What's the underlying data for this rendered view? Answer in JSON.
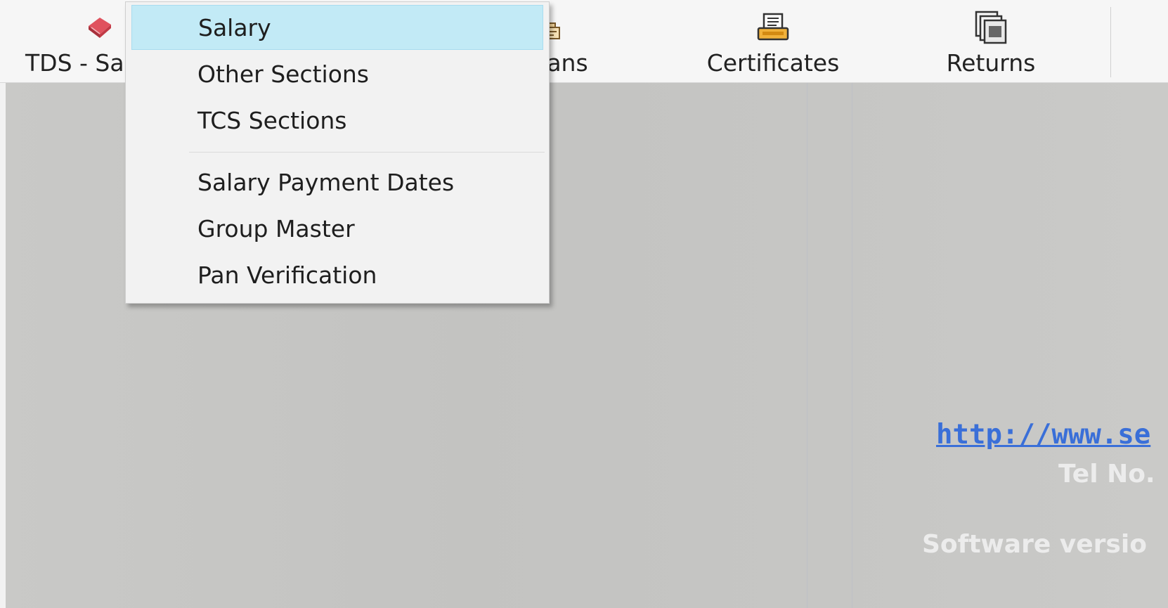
{
  "toolbar": {
    "buttons": [
      {
        "label": "TDS - Sal",
        "icon": "book-icon"
      },
      {
        "label": "llans",
        "icon": "challan-icon"
      },
      {
        "label": "Certificates",
        "icon": "certificate-icon"
      },
      {
        "label": "Returns",
        "icon": "returns-icon"
      }
    ]
  },
  "dropdown": {
    "items": [
      {
        "label": "Salary",
        "highlighted": true
      },
      {
        "label": "Other Sections"
      },
      {
        "label": "TCS Sections"
      },
      {
        "label": "Salary Payment Dates"
      },
      {
        "label": "Group Master"
      },
      {
        "label": "Pan Verification"
      }
    ]
  },
  "main": {
    "website": "http://www.se",
    "tel_label": "Tel No.",
    "version_label": "Software versio"
  },
  "colors": {
    "highlight": "#c2eaf6",
    "link": "#3a6fd8",
    "workspace": "#c4c4c2"
  }
}
